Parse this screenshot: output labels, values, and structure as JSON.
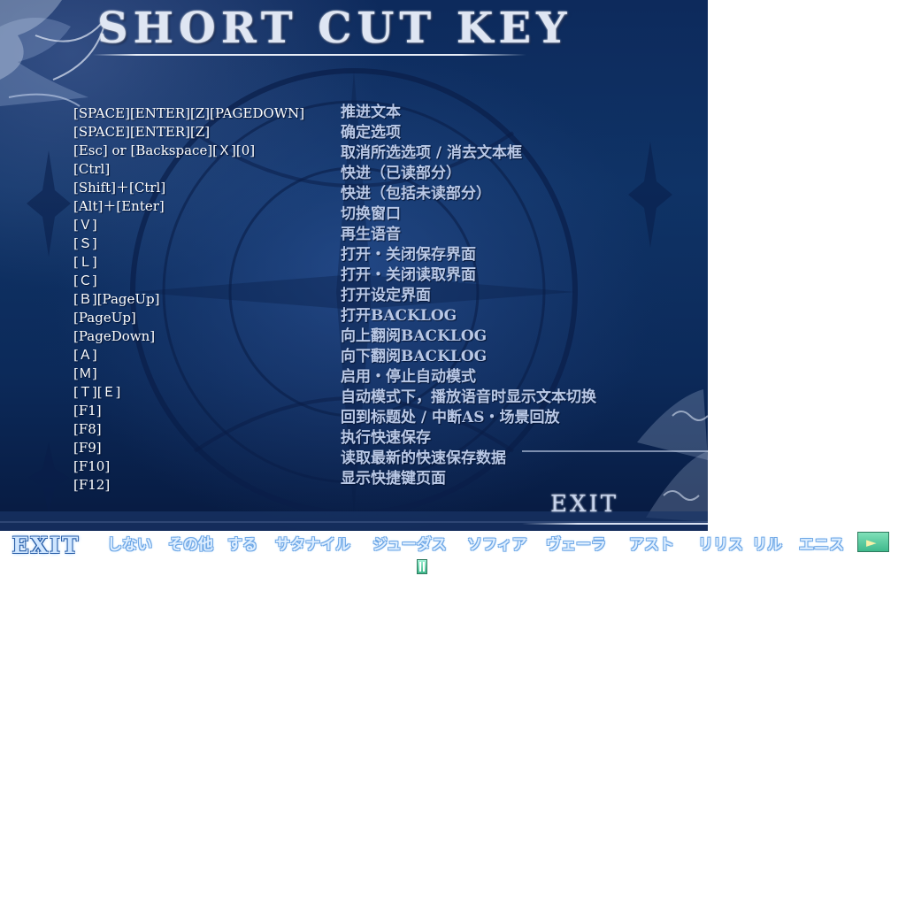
{
  "title": "SHORT CUT KEY",
  "shortcuts": [
    {
      "key": "[SPACE][ENTER][Z][PAGEDOWN]",
      "action": "推进文本"
    },
    {
      "key": "[SPACE][ENTER][Z]",
      "action": "确定选项"
    },
    {
      "key": "[Esc] or [Backspace][Ｘ][0]",
      "action": "取消所选选项 / 消去文本框"
    },
    {
      "key": "[Ctrl]",
      "action": "快进（已读部分）"
    },
    {
      "key": "[Shift]＋[Ctrl]",
      "action": "快进（包括未读部分）"
    },
    {
      "key": "[Alt]＋[Enter]",
      "action": "切换窗口"
    },
    {
      "key": "[Ｖ]",
      "action": "再生语音"
    },
    {
      "key": "[Ｓ]",
      "action": "打开・关闭保存界面"
    },
    {
      "key": "[Ｌ]",
      "action": "打开・关闭读取界面"
    },
    {
      "key": "[Ｃ]",
      "action": "打开设定界面"
    },
    {
      "key": "[Ｂ][PageUp]",
      "action": "打开BACKLOG"
    },
    {
      "key": "[PageUp]",
      "action": "向上翻阅BACKLOG"
    },
    {
      "key": "[PageDown]",
      "action": "向下翻阅BACKLOG"
    },
    {
      "key": "[Ａ]",
      "action": "启用・停止自动模式"
    },
    {
      "key": "[Ｍ]",
      "action": "自动模式下，播放语音时显示文本切换"
    },
    {
      "key": "[Ｔ][Ｅ]",
      "action": "回到标题处 / 中断AS・场景回放"
    },
    {
      "key": "[F1]",
      "action": "执行快速保存"
    },
    {
      "key": "[F8]",
      "action": "读取最新的快速保存数据"
    },
    {
      "key": "[F9]",
      "action": ""
    },
    {
      "key": "[F10]",
      "action": ""
    },
    {
      "key": "[F12]",
      "action": "显示快捷键页面"
    }
  ],
  "exit_label": "EXIT",
  "toolbar": {
    "exit_label": "EXIT",
    "items": [
      "しない",
      "その他",
      "する",
      "サタナイル",
      "ジューダス",
      "ソフィア",
      "ヴェーラ",
      "アスト",
      "リリス",
      "リル",
      "エニス"
    ],
    "next_symbol": "►",
    "pause_label": ""
  },
  "colors": {
    "background": "#0f3366",
    "key_text": "#ffffff",
    "desc_text": "#b9c8e6",
    "toolbar_text": "#dfefff",
    "button_green": "#3fb98c"
  }
}
